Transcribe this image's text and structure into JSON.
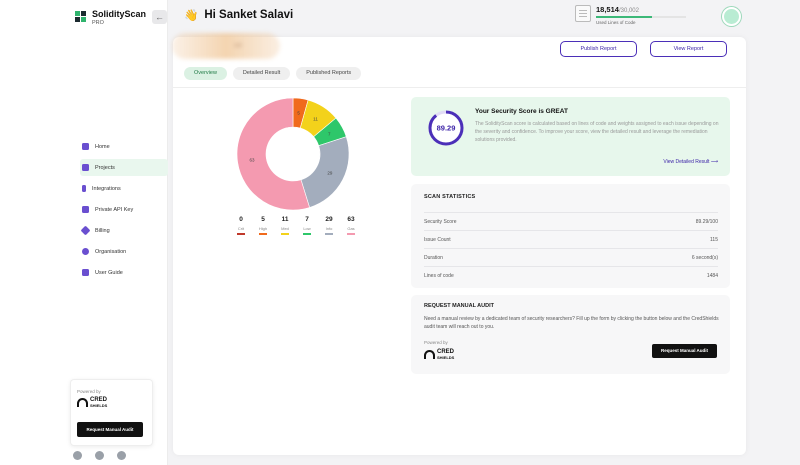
{
  "app": {
    "name": "SolidityScan",
    "plan": "PRO"
  },
  "header": {
    "greeting_emoji": "👋",
    "greeting": "Hi Sanket Salavi",
    "loc_used": "18,514",
    "loc_total": "/30,002",
    "loc_label": "Used Lines of Code",
    "loc_fraction": 0.617
  },
  "project": {
    "name_blurred": "sol"
  },
  "actions": {
    "publish": "Publish Report",
    "view": "View Report"
  },
  "tabs": [
    {
      "label": "Overview",
      "active": true
    },
    {
      "label": "Detailed Result",
      "active": false
    },
    {
      "label": "Published Reports",
      "active": false
    }
  ],
  "sidebar": {
    "items": [
      {
        "label": "Home",
        "icon": "home-icon",
        "color": "#5a3fc0"
      },
      {
        "label": "Projects",
        "icon": "projects-icon",
        "color": "#5a3fc0",
        "active": true
      },
      {
        "label": "Integrations",
        "icon": "integrations-icon",
        "color": "#5a3fc0"
      },
      {
        "label": "Private API Key",
        "icon": "api-key-icon",
        "color": "#5a3fc0"
      },
      {
        "label": "Billing",
        "icon": "billing-icon",
        "color": "#5a3fc0"
      },
      {
        "label": "Organisation",
        "icon": "organisation-icon",
        "color": "#5a3fc0"
      },
      {
        "label": "User Guide",
        "icon": "user-guide-icon",
        "color": "#5a3fc0"
      }
    ],
    "promo": {
      "powered_by": "Powered by",
      "brand": "CRED",
      "brand_sub": "SHIELDS",
      "button": "Request Manual Audit"
    },
    "socials": [
      "telegram-icon",
      "discord-icon",
      "twitter-icon"
    ]
  },
  "chart_data": {
    "type": "pie",
    "donut": true,
    "categories": [
      "Crit",
      "High",
      "Med",
      "Low",
      "Info",
      "Gas"
    ],
    "values": [
      0,
      5,
      11,
      7,
      29,
      63
    ],
    "colors": [
      "#c0392b",
      "#f06a1c",
      "#f3d21b",
      "#2ec76a",
      "#a3adbd",
      "#f49ab0"
    ]
  },
  "score": {
    "value": "89.29",
    "fraction": 0.8929,
    "title": "Your Security Score is GREAT",
    "description": "The SolidityScan score is calculated based on lines of code and weights assigned to each issue depending on the severity and confidence. To improve your score, view the detailed result and leverage the remediation solutions provided.",
    "link": "View Detailed Result ⟶"
  },
  "stats": {
    "title": "SCAN STATISTICS",
    "rows": [
      {
        "label": "Security Score",
        "value": "89.29/100"
      },
      {
        "label": "Issue Count",
        "value": "115"
      },
      {
        "label": "Duration",
        "value": "6 second(s)"
      },
      {
        "label": "Lines of code",
        "value": "1484"
      }
    ]
  },
  "audit": {
    "title": "REQUEST MANUAL AUDIT",
    "description": "Need a manual review by a dedicated team of security researchers? Fill up the form by clicking the button below and the CredShields audit team will reach out to you.",
    "powered_by": "Powered by",
    "brand": "CRED",
    "brand_sub": "SHIELDS",
    "button": "Request Manual Audit"
  }
}
